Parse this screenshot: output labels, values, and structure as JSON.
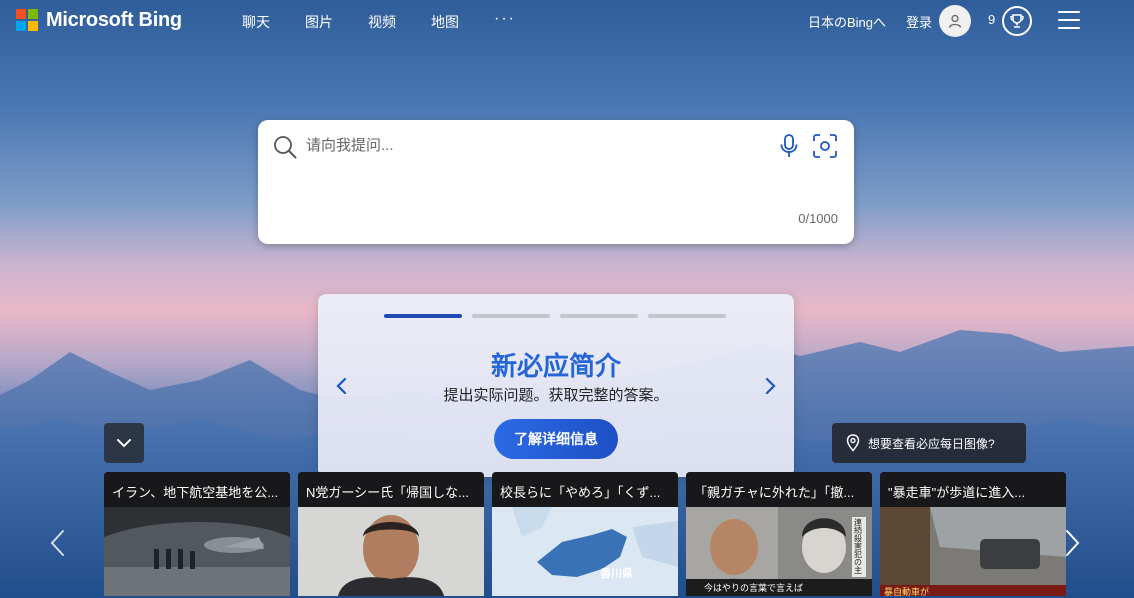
{
  "header": {
    "brand": "Microsoft Bing",
    "nav": [
      "聊天",
      "图片",
      "视频",
      "地图"
    ],
    "more": "···",
    "region": "日本のBingへ",
    "login": "登录",
    "points": "9",
    "logo_colors": [
      "#f25022",
      "#7fba00",
      "#00a4ef",
      "#ffb900"
    ]
  },
  "search": {
    "placeholder": "请向我提问...",
    "value": "",
    "char_count": "0/1000"
  },
  "promo": {
    "title": "新必应简介",
    "subtitle": "提出实际问题。获取完整的答案。",
    "button": "了解详细信息",
    "slide_count": 4,
    "active_slide": 1
  },
  "image_info": {
    "label": "想要查看必应每日图像?"
  },
  "news": [
    {
      "title": "イラン、地下航空基地を公..."
    },
    {
      "title": "N党ガーシー氏「帰国しな..."
    },
    {
      "title": "校長らに「やめろ」「くず..."
    },
    {
      "title": "「親ガチャに外れた」「撤..."
    },
    {
      "title": "\"暴走車\"が歩道に進入..."
    }
  ],
  "news_images": {
    "map_label": "香川県",
    "tv_caption": "今はやりの言葉で言えば",
    "side_caption": "連続殺害犯の主",
    "card5_strip": "暴自動車が"
  },
  "colors": {
    "accent": "#2465d8",
    "icon_blue": "#1a56c8",
    "progress_active": "#1f48b0"
  }
}
